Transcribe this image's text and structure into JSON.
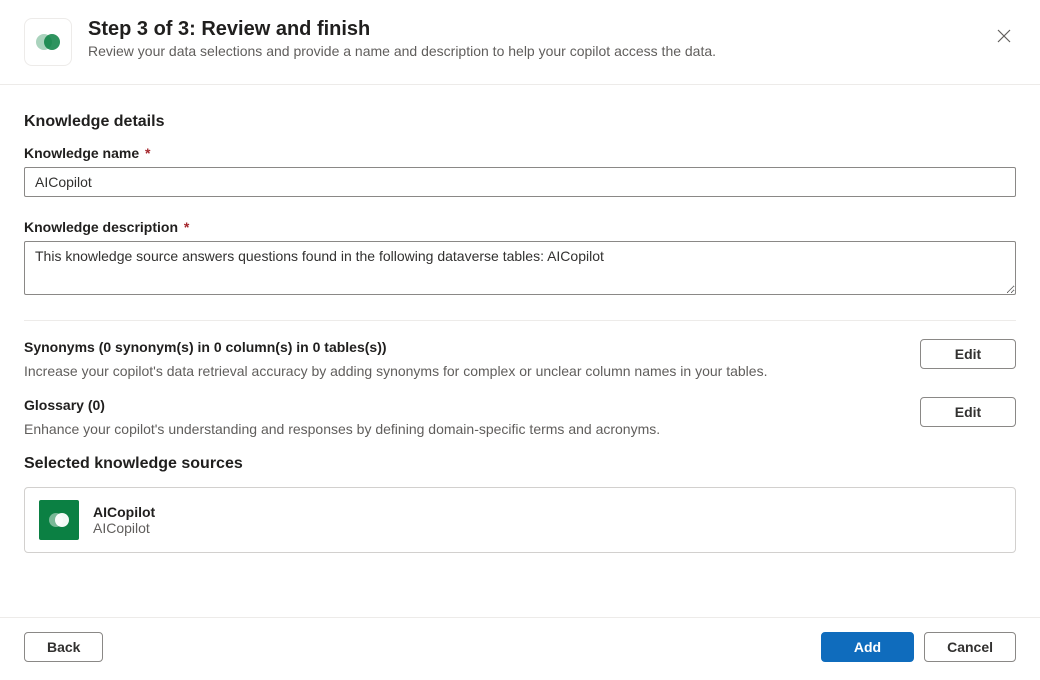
{
  "header": {
    "title": "Step 3 of 3: Review and finish",
    "subtitle": "Review your data selections and provide a name and description to help your copilot access the data."
  },
  "details": {
    "section_title": "Knowledge details",
    "name_label": "Knowledge name",
    "name_value": "AICopilot",
    "desc_label": "Knowledge description",
    "desc_value": "This knowledge source answers questions found in the following dataverse tables: AICopilot"
  },
  "synonyms": {
    "title": "Synonyms (0 synonym(s) in 0 column(s) in 0 tables(s))",
    "desc": "Increase your copilot's data retrieval accuracy by adding synonyms for complex or unclear column names in your tables.",
    "edit_label": "Edit"
  },
  "glossary": {
    "title": "Glossary (0)",
    "desc": "Enhance your copilot's understanding and responses by defining domain-specific terms and acronyms.",
    "edit_label": "Edit"
  },
  "sources": {
    "title": "Selected knowledge sources",
    "items": [
      {
        "name": "AICopilot",
        "sub": "AICopilot"
      }
    ]
  },
  "footer": {
    "back_label": "Back",
    "add_label": "Add",
    "cancel_label": "Cancel"
  }
}
